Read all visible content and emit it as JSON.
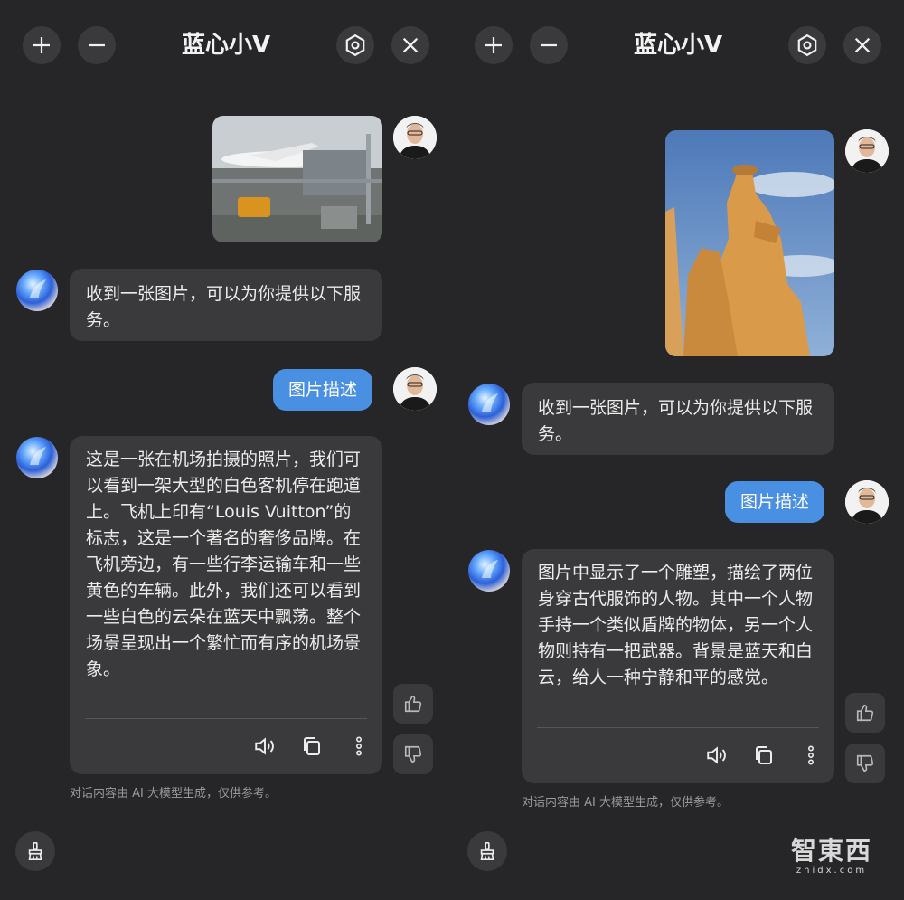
{
  "colors": {
    "accent": "#4a90e2",
    "bubble": "#3a3a3c",
    "bg": "#262628"
  },
  "left": {
    "title": "蓝心小V",
    "ai_intro": "收到一张图片，可以为你提供以下服务。",
    "user_action": "图片描述",
    "ai_reply": "这是一张在机场拍摄的照片，我们可以看到一架大型的白色客机停在跑道上。飞机上印有“Louis Vuitton”的标志，这是一个著名的奢侈品牌。在飞机旁边，有一些行李运输车和一些黄色的车辆。此外，我们还可以看到一些白色的云朵在蓝天中飘荡。整个场景呈现出一个繁忙而有序的机场景象。",
    "disclaimer": "对话内容由 AI 大模型生成，仅供参考。"
  },
  "right": {
    "title": "蓝心小V",
    "ai_intro": "收到一张图片，可以为你提供以下服务。",
    "user_action": "图片描述",
    "ai_reply": "图片中显示了一个雕塑，描绘了两位身穿古代服饰的人物。其中一个人物手持一个类似盾牌的物体，另一个人物则持有一把武器。背景是蓝天和白云，给人一种宁静和平的感觉。",
    "disclaimer": "对话内容由 AI 大模型生成，仅供参考。"
  },
  "icons": {
    "add": "plus-icon",
    "minimize": "minus-icon",
    "settings": "hexagon-settings-icon",
    "close": "close-icon",
    "speaker": "speaker-icon",
    "copy": "copy-icon",
    "more": "more-vertical-icon",
    "like": "thumbs-up-icon",
    "dislike": "thumbs-down-icon",
    "clear": "broom-icon"
  },
  "watermark": {
    "logo": "智東西",
    "domain": "zhidx.com"
  }
}
